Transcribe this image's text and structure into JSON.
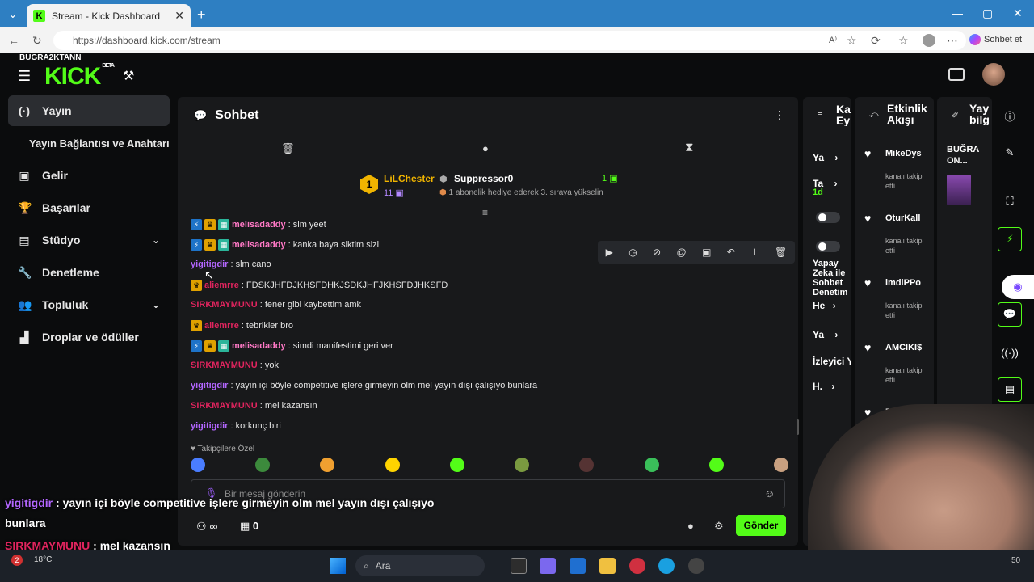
{
  "browser": {
    "tab_title": "Stream - Kick Dashboard",
    "url": "https://dashboard.kick.com/stream",
    "copilot_label": "Sohbet et"
  },
  "brand": {
    "channel": "BUGRA2KTANN",
    "logo": "KICK",
    "logo_sup": "BETA"
  },
  "sidebar": {
    "items": [
      {
        "label": "Yayın",
        "icon": "broadcast-icon"
      },
      {
        "label": "Yayın Bağlantısı ve Anahtarı",
        "icon": ""
      },
      {
        "label": "Gelir",
        "icon": "revenue-icon"
      },
      {
        "label": "Başarılar",
        "icon": "trophy-icon"
      },
      {
        "label": "Stüdyo",
        "icon": "studio-icon"
      },
      {
        "label": "Denetleme",
        "icon": "wrench-icon"
      },
      {
        "label": "Topluluk",
        "icon": "community-icon"
      },
      {
        "label": "Droplar ve ödüller",
        "icon": "drops-icon"
      }
    ]
  },
  "chat": {
    "title": "Sohbet",
    "pinned": {
      "gifter": "LiLChester",
      "gifter_count": "11",
      "rank": "1",
      "recipient": "Suppressor0",
      "recipient_count": "1",
      "message": "1 abonelik hediye ederek 3. sıraya yükselin"
    },
    "messages": [
      {
        "user": "melisadaddy",
        "text": ": slm yeet",
        "color": "#ff79c6",
        "badges": [
          "blue",
          "gold",
          "green"
        ]
      },
      {
        "user": "melisadaddy",
        "text": ": kanka baya siktim sizi",
        "color": "#ff79c6",
        "badges": [
          "blue",
          "gold",
          "green"
        ]
      },
      {
        "user": "yigitigdir",
        "text": ": slm cano",
        "color": "#b366ff",
        "badges": []
      },
      {
        "user": "aliemrre",
        "text": ": FDSKJHFDJKHSFDHKJSDKJHFJKHSFDJHKSFD",
        "color": "#e0245e",
        "badges": [
          "gold"
        ]
      },
      {
        "user": "SIRKMAYMUNU",
        "text": ": fener gibi kaybettim amk",
        "color": "#e0245e",
        "badges": []
      },
      {
        "user": "aliemrre",
        "text": ": tebrikler bro",
        "color": "#e0245e",
        "badges": [
          "gold"
        ]
      },
      {
        "user": "melisadaddy",
        "text": ": simdi manifestimi geri ver",
        "color": "#ff79c6",
        "badges": [
          "blue",
          "gold",
          "green"
        ]
      },
      {
        "user": "SIRKMAYMUNU",
        "text": ": yok",
        "color": "#e0245e",
        "badges": []
      },
      {
        "user": "yigitigdir",
        "text": ": yayın içi böyle competitive işlere girmeyin olm mel yayın dışı çalışıyo bunlara",
        "color": "#b366ff",
        "badges": []
      },
      {
        "user": "SIRKMAYMUNU",
        "text": ": mel kazansın",
        "color": "#e0245e",
        "badges": []
      },
      {
        "user": "yigitigdir",
        "text": ": korkunç biri",
        "color": "#b366ff",
        "badges": []
      }
    ],
    "followers_only": "Takipçilere Özel",
    "input_placeholder": "Bir mesaj gönderin",
    "viewer_count": "∞",
    "gift_count": "0",
    "send_label": "Gönder"
  },
  "panels": {
    "actions": {
      "title": "Kanal Eylemleri",
      "title_visible": "Ka Ey",
      "rows": [
        "Ya",
        "Ta",
        "1d",
        "Yapay Zeka ile Sohbet Denetim",
        "He",
        "Ya",
        "İzleyici Y",
        "H."
      ]
    },
    "activity": {
      "title": "Etkinlik Akışı",
      "follow_sub": "kanalı takip etti",
      "items": [
        "MikeDys",
        "OturKall",
        "imdiPPo",
        "AMCIKI$",
        "ETH"
      ]
    },
    "stream_info": {
      "title": "Yayın bilgi",
      "title_visible": "Yay bilg",
      "name": "BUĞRA ON..."
    }
  },
  "overlay": {
    "lines": [
      {
        "user": "yigitigdir",
        "text": " : yayın içi böyle competitive işlere girmeyin olm mel yayın dışı çalışıyo"
      },
      {
        "user": "",
        "text": "bunlara"
      },
      {
        "user": "SIRKMAYMUNU",
        "text": " : mel kazansın"
      },
      {
        "user": "yigitigdir",
        "text": " korkunç biri"
      }
    ]
  },
  "taskbar": {
    "search": "Ara",
    "weather": "18°C",
    "notif": "2",
    "clock_frag": "50"
  }
}
